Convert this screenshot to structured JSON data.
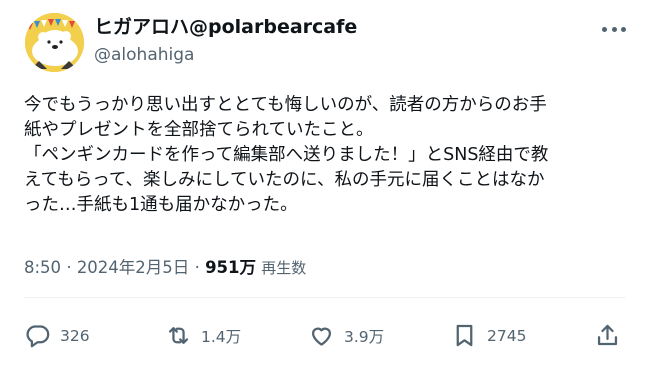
{
  "tweet": {
    "display_name": "ヒガアロハ@polarbearcafe",
    "handle": "@alohahiga",
    "text": "今でもうっかり思い出すととても悔しいのが、読者の方からのお手\n紙やプレゼントを全部捨てられていたこと。\n「ペンギンカードを作って編集部へ送りました！」とSNS経由で教\nえてもらって、楽しみにしていたのに、私の手元に届くことはなか\nった…手紙も1通も届かなかった。",
    "time": "8:50",
    "date": "2024年2月5日",
    "separator1": "·",
    "separator2": "·",
    "views": "951万",
    "views_label": "再生数"
  },
  "actions": {
    "replies": "326",
    "reposts": "1.4万",
    "likes": "3.9万",
    "bookmarks": "2745"
  },
  "icons": {
    "avatar": "polar-bear-avatar",
    "more": "more-icon",
    "reply": "reply-icon",
    "repost": "repost-icon",
    "like": "heart-icon",
    "bookmark": "bookmark-icon",
    "share": "share-icon"
  },
  "colors": {
    "text": "#0f1419",
    "secondary": "#536471",
    "avatar_bg": "#f2cf4c"
  }
}
